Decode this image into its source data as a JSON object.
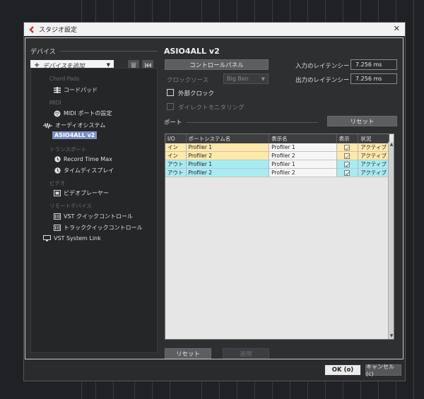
{
  "window": {
    "title": "スタジオ設定",
    "close_glyph": "✕"
  },
  "left_panel": {
    "header": "デバイス",
    "add_device_placeholder": "デバイスを追加",
    "tree": {
      "chord_pads_category": "Chord Pads",
      "chord_pads_item": "コードパッド",
      "midi_category": "MIDI",
      "midi_port_item": "MIDI ポートの設定",
      "audio_system_item": "オーディオシステム",
      "asio_item": "ASIO4ALL v2",
      "transport_category": "トランスポート",
      "record_time_max_item": "Record Time Max",
      "time_display_item": "タイムディスプレイ",
      "video_category": "ビデオ",
      "video_player_item": "ビデオプレーヤー",
      "remote_category": "リモートデバイス",
      "vst_quick_item": "VST クイックコントロール",
      "track_quick_item": "トラッククイックコントロール",
      "vst_system_link_item": "VST System Link"
    }
  },
  "right_panel": {
    "device_title": "ASIO4ALL v2",
    "control_panel_button": "コントロールパネル",
    "clock_source_label": "クロックソース",
    "clock_source_value": "Big Ben",
    "external_clock_label": "外部クロック",
    "direct_monitoring_label": "ダイレクトモニタリング",
    "input_latency_label": "入力のレイテンシー",
    "input_latency_value": "7.256 ms",
    "output_latency_label": "出力のレイテンシー",
    "output_latency_value": "7.256 ms",
    "ports_label": "ポート",
    "reset_button_top": "リセット",
    "table": {
      "headers": [
        "I/O",
        "ポートシステム名",
        "表示名",
        "表示",
        "状況"
      ],
      "rows": [
        {
          "io": "イン",
          "system_name": "Profiler 1",
          "display_name": "Profiler 1",
          "status": "アクティブ"
        },
        {
          "io": "イン",
          "system_name": "Profiler 2",
          "display_name": "Profiler 2",
          "status": "アクティブ"
        },
        {
          "io": "アウト",
          "system_name": "Profiler 1",
          "display_name": "Profiler 1",
          "status": "アクティブ"
        },
        {
          "io": "アウト",
          "system_name": "Profiler 2",
          "display_name": "Profiler 2",
          "status": "アクティブ"
        }
      ]
    },
    "reset_button_bottom": "リセット",
    "apply_button": "適用"
  },
  "footer": {
    "ok_button": "OK (o)",
    "cancel_button": "キャンセル (c)"
  },
  "colors": {
    "in_row": "#ffe9a8",
    "out_row": "#a6ecf2",
    "selected": "#7b8fc7",
    "app_icon": "#d0322d"
  }
}
